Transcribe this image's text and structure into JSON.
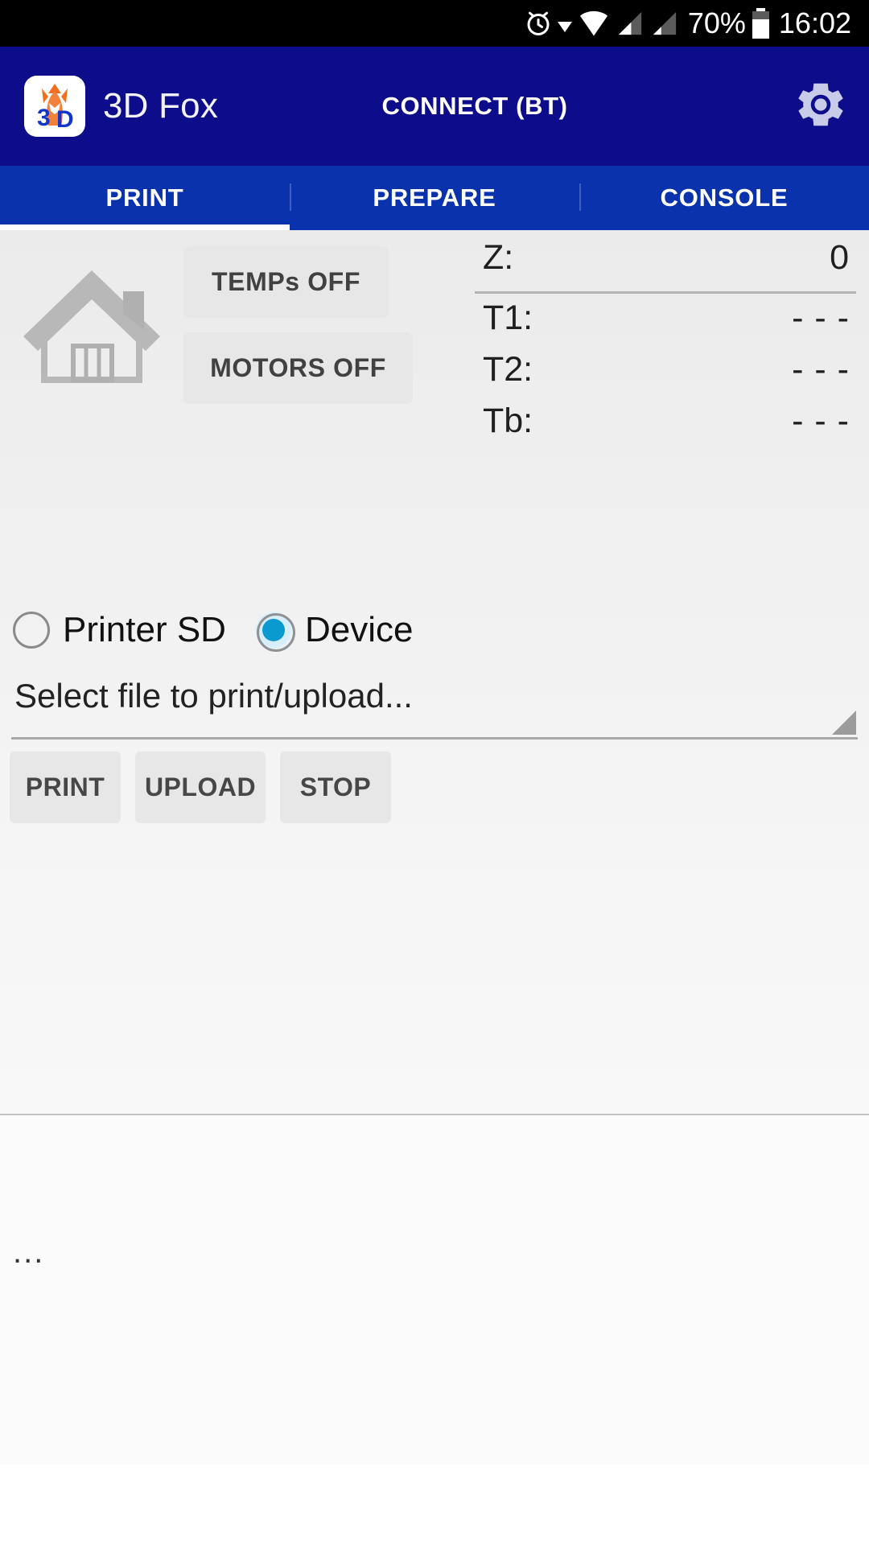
{
  "statusbar": {
    "alarm_icon": "alarm-clock-icon",
    "caret_icon": "dropdown-caret-icon",
    "wifi_icon": "wifi-icon",
    "signal1_icon": "cellular-signal-icon",
    "signal2_icon": "cellular-signal-icon",
    "battery_percent": "70%",
    "battery_icon": "battery-icon",
    "clock": "16:02"
  },
  "appbar": {
    "logo_icon": "3d-fox-logo",
    "title": "3D Fox",
    "connect_label": "CONNECT (BT)",
    "settings_icon": "gear-icon",
    "bg_color": "#0d0d8c"
  },
  "tabs": {
    "bg_color": "#0a32ac",
    "selected_index": 0,
    "items": [
      {
        "label": "PRINT"
      },
      {
        "label": "PREPARE"
      },
      {
        "label": "CONSOLE"
      }
    ]
  },
  "main": {
    "home_icon": "home-icon",
    "temps_button": "TEMPs OFF",
    "motors_button": "MOTORS OFF",
    "readouts": [
      {
        "label": "Z:",
        "value": "0"
      },
      {
        "label": "T1:",
        "value": "- - -"
      },
      {
        "label": "T2:",
        "value": "- - -"
      },
      {
        "label": "Tb:",
        "value": "- - -"
      }
    ],
    "source": {
      "options": [
        {
          "label": "Printer SD",
          "selected": false
        },
        {
          "label": "Device",
          "selected": true
        }
      ],
      "selected_color": "#0a9ad0"
    },
    "file_spinner": {
      "value": "Select file to print/upload...",
      "caret_icon": "spinner-caret-icon"
    },
    "actions": [
      {
        "label": "PRINT"
      },
      {
        "label": "UPLOAD"
      },
      {
        "label": "STOP"
      }
    ],
    "footer_text": "..."
  }
}
